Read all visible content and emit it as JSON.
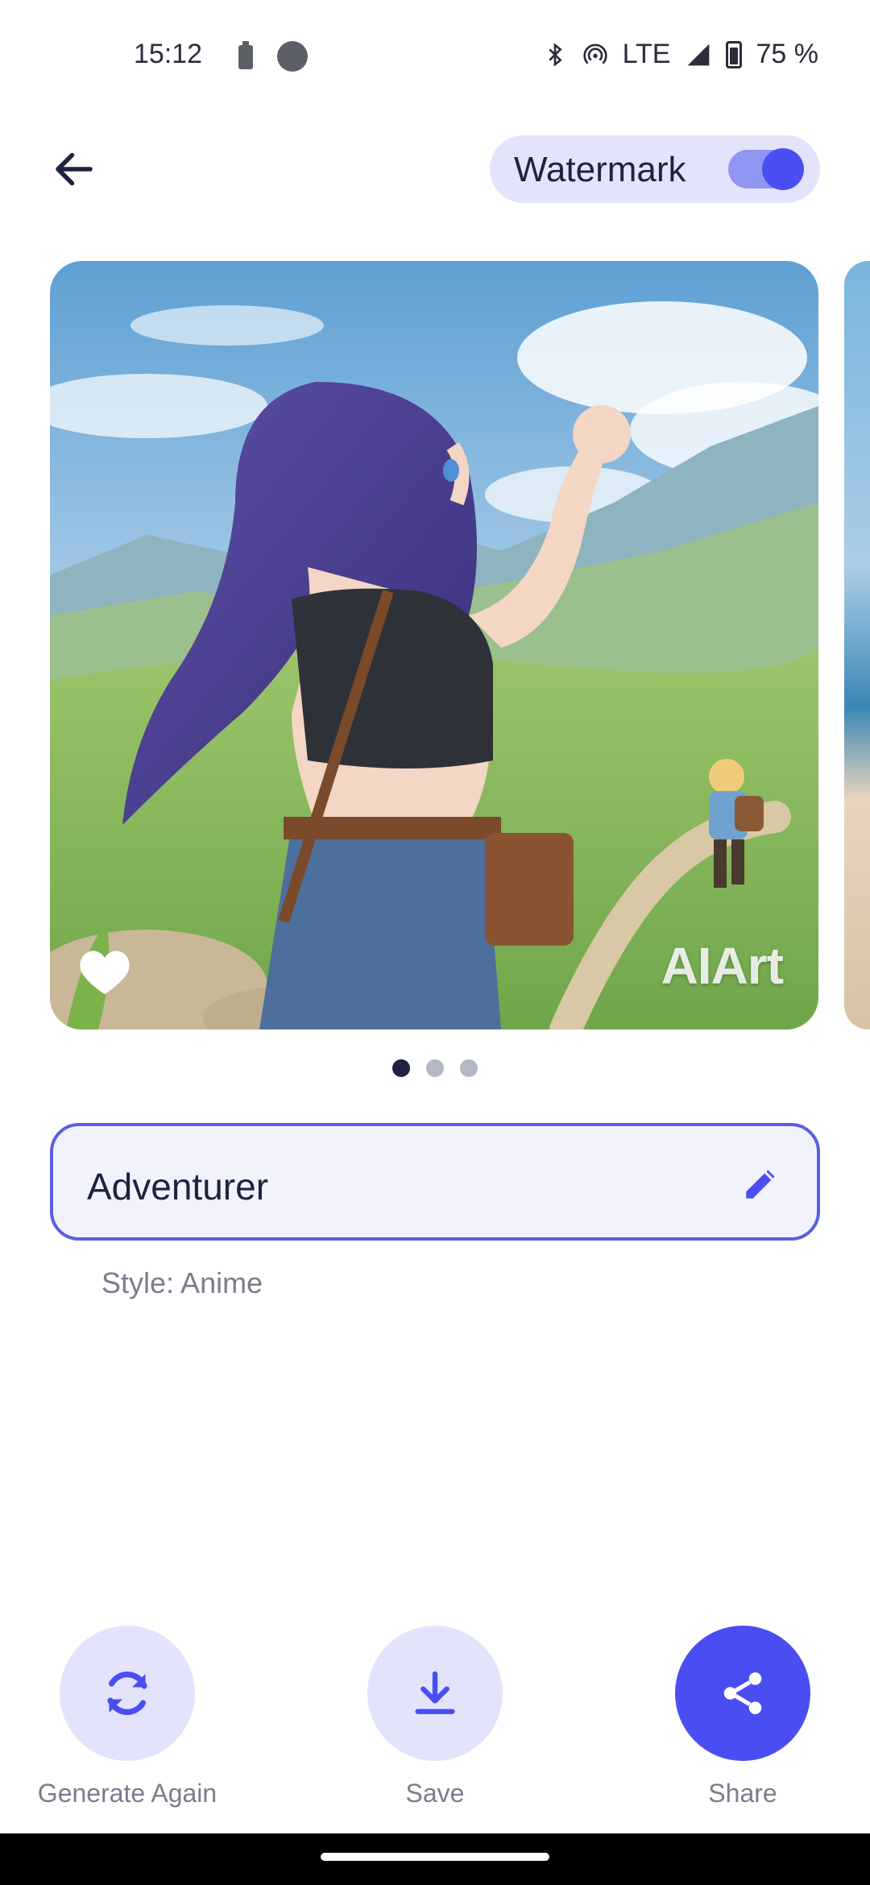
{
  "status_bar": {
    "time": "15:12",
    "network": "LTE",
    "battery": "75 %"
  },
  "header": {
    "watermark_label": "Watermark",
    "watermark_enabled": true
  },
  "carousel": {
    "image_watermark": "AIArt",
    "page_count": 3,
    "active_page": 1
  },
  "artwork": {
    "title": "Adventurer",
    "style": "Style: Anime"
  },
  "actions": [
    {
      "label": "Generate Again",
      "icon": "refresh-icon"
    },
    {
      "label": "Save",
      "icon": "download-icon"
    },
    {
      "label": "Share",
      "icon": "share-icon"
    }
  ],
  "colors": {
    "accent": "#4a4ef2",
    "accent_light": "#e3e4fb",
    "text_primary": "#1f2340",
    "text_secondary": "#7a7d8c"
  }
}
